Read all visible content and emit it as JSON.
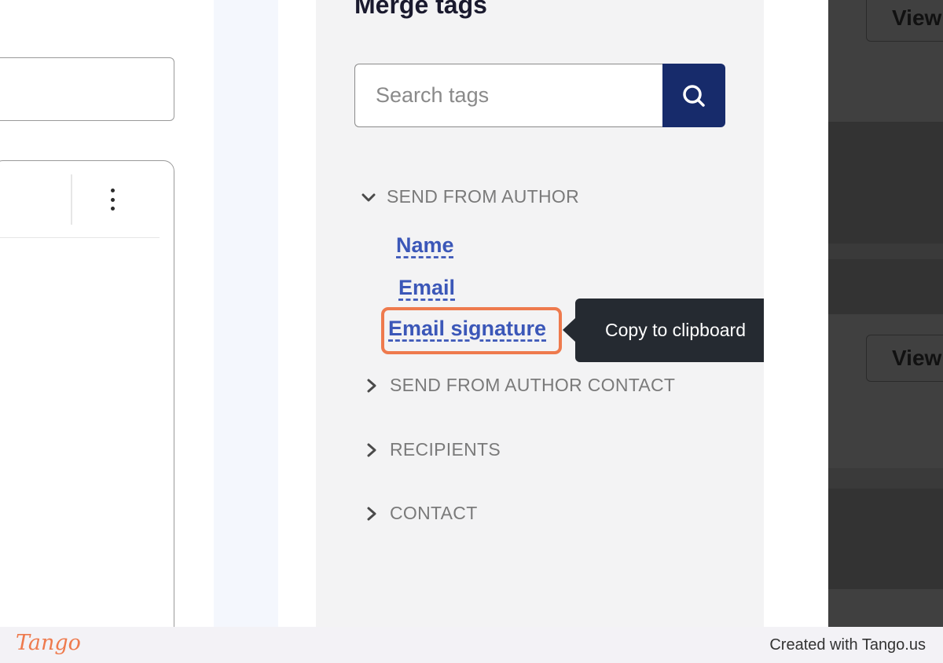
{
  "panel": {
    "title": "Merge tags",
    "search_placeholder": "Search tags"
  },
  "sections": [
    {
      "label": "SEND FROM AUTHOR",
      "expanded": true,
      "tags": [
        "Name",
        "Email",
        "Email signature"
      ]
    },
    {
      "label": "SEND FROM AUTHOR CONTACT",
      "expanded": false
    },
    {
      "label": "RECIPIENTS",
      "expanded": false
    },
    {
      "label": "CONTACT",
      "expanded": false
    }
  ],
  "tooltip": {
    "text": "Copy to clipboard"
  },
  "background": {
    "view_buttons": [
      "View",
      "View"
    ]
  },
  "footer": {
    "brand": "Tango",
    "credit": "Created with Tango.us"
  },
  "colors": {
    "accent": "#172b6b",
    "highlight": "#ee7a4d",
    "link": "#3b57b8",
    "tooltip_bg": "#252a31"
  }
}
